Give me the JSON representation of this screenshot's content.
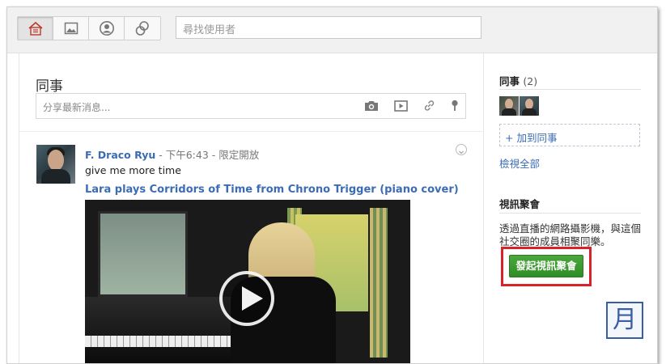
{
  "nav": {
    "icons": [
      "stream-home-icon",
      "photos-icon",
      "profile-icon",
      "circles-icon"
    ]
  },
  "search": {
    "placeholder": "尋找使用者"
  },
  "stream": {
    "title": "同事",
    "share_placeholder": "分享最新消息...",
    "share_icons": [
      "camera-icon",
      "video-icon",
      "link-icon",
      "location-pin-icon"
    ]
  },
  "post": {
    "author": "F. Draco Ryu",
    "sep1": " - ",
    "time": "下午6:43",
    "sep2": " - ",
    "visibility": "限定開放",
    "text": "give me more time",
    "link_title": "Lara plays Corridors of Time from Chrono Trigger (piano cover)"
  },
  "sidebar": {
    "circle_title": "同事",
    "circle_count": "(2)",
    "add_label": "+ 加到同事",
    "view_all": "檢視全部",
    "hangout_title": "視訊聚會",
    "hangout_desc": "透過直播的網路攝影機，與這個社交圈的成員相聚同樂。",
    "hangout_button": "發起視訊聚會",
    "stamp": "月"
  },
  "colors": {
    "link": "#3b6cb4",
    "hangout_green": "#3a9a30",
    "highlight_red": "#d8232a"
  }
}
